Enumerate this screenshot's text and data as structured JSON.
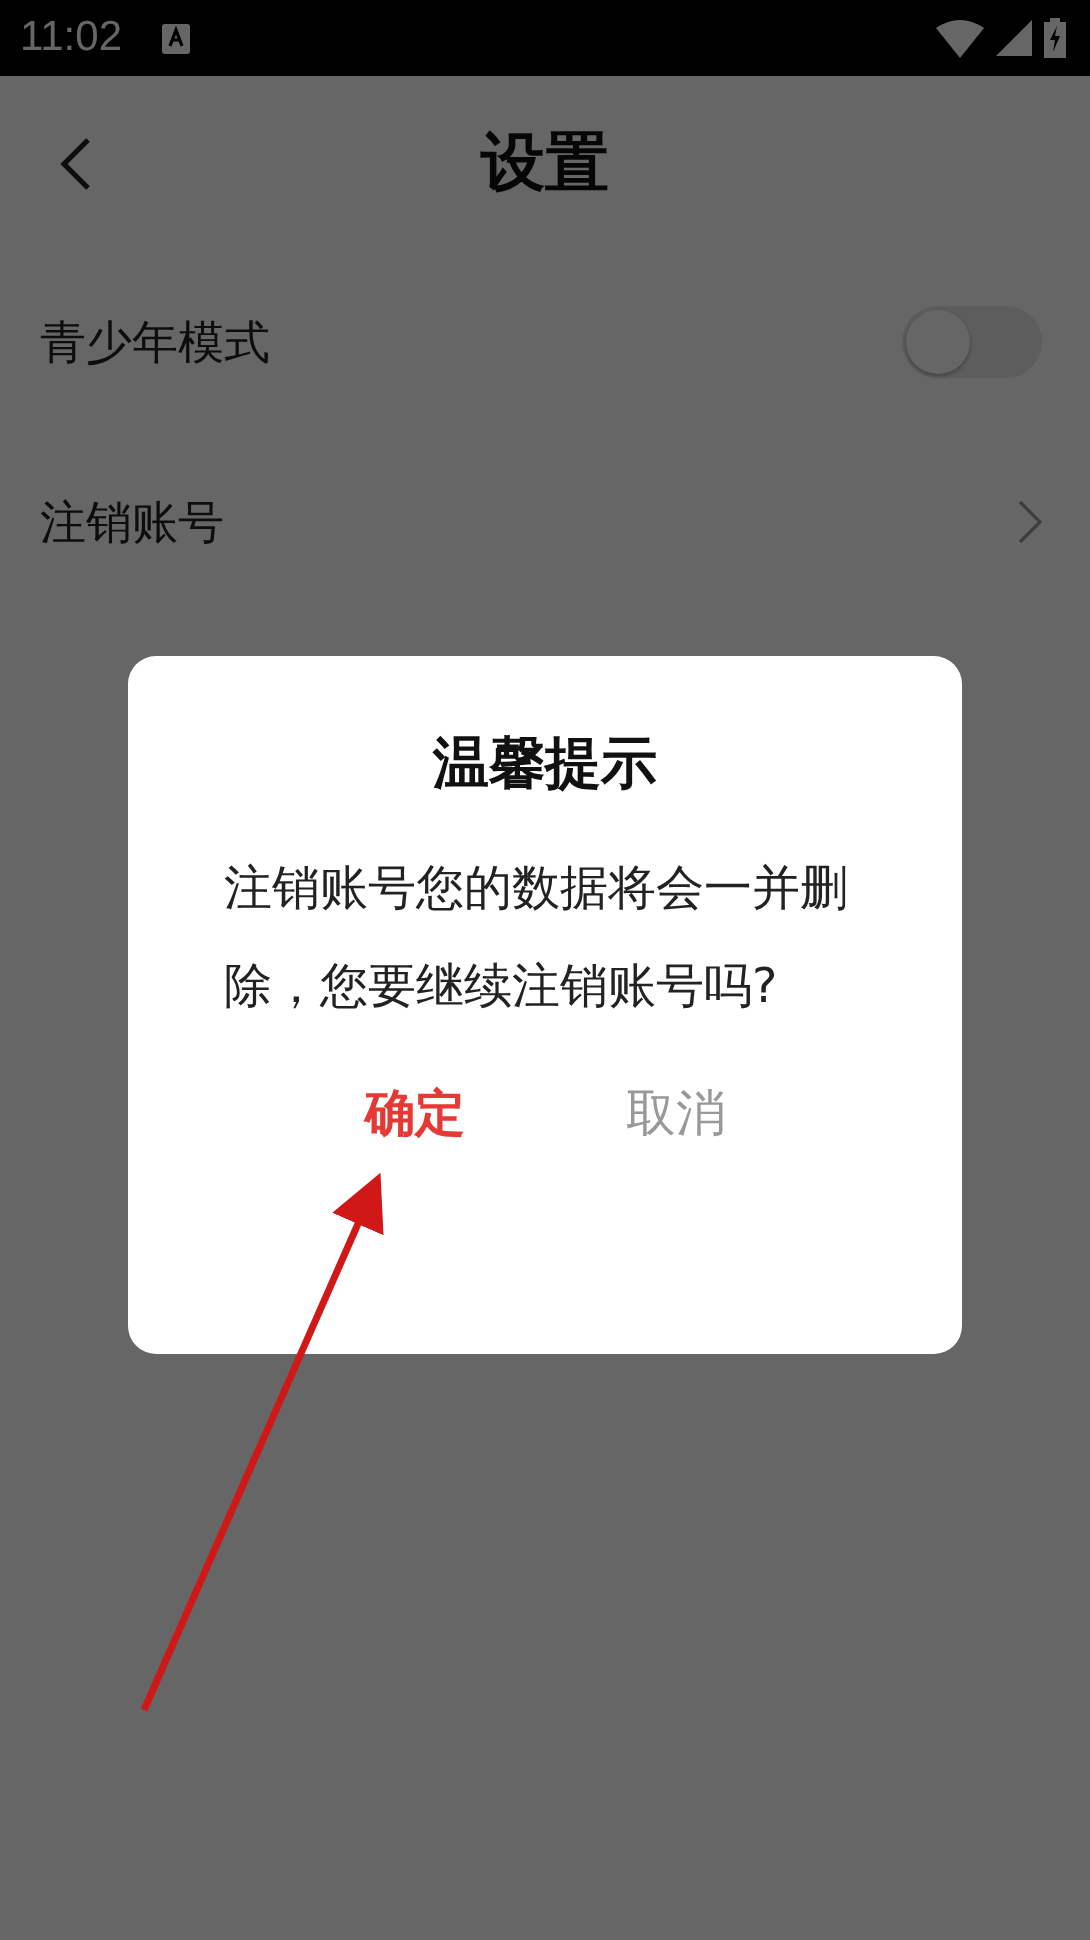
{
  "status_bar": {
    "time": "11:02"
  },
  "nav": {
    "title": "设置"
  },
  "settings": [
    {
      "kind": "toggle",
      "label": "青少年模式",
      "on": false
    },
    {
      "kind": "link",
      "label": "注销账号"
    }
  ],
  "dialog": {
    "title": "温馨提示",
    "message": "注销账号您的数据将会一并删除，您要继续注销账号吗?",
    "buttons": [
      {
        "kind": "primary",
        "label": "确定"
      },
      {
        "kind": "secondary",
        "label": "取消"
      }
    ]
  },
  "annotation": {
    "kind": "arrow"
  }
}
